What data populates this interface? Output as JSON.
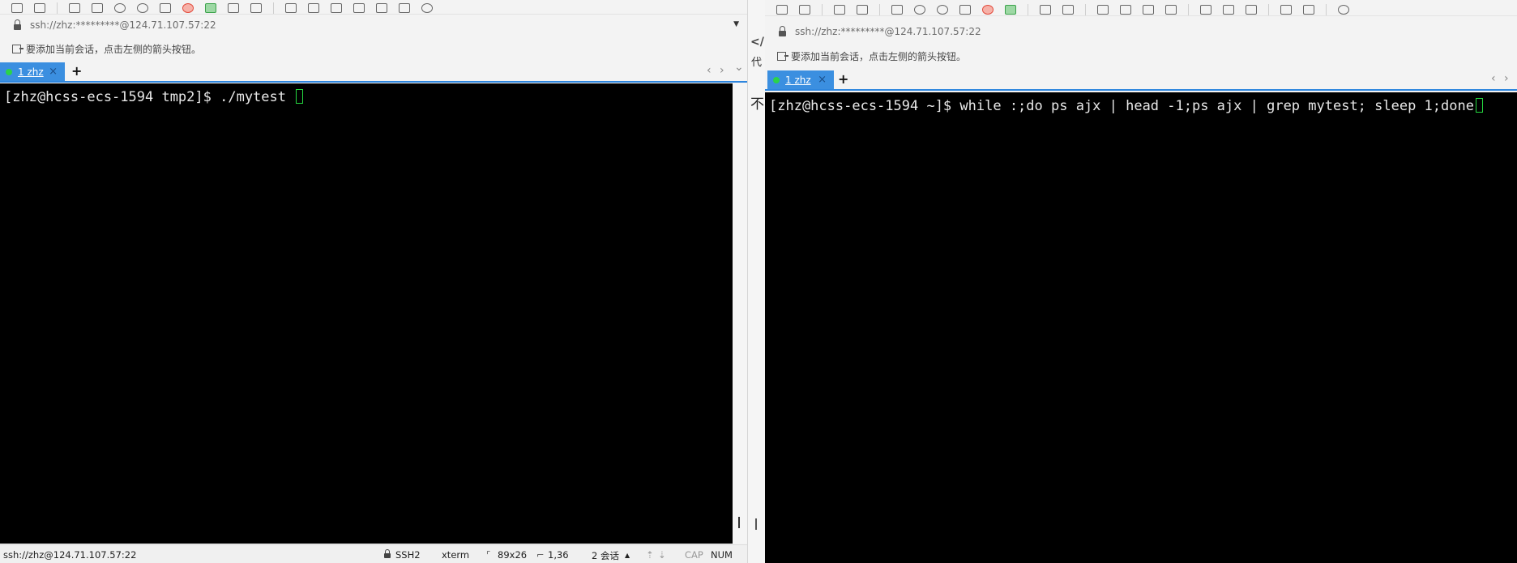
{
  "left": {
    "address": "ssh://zhz:*********@124.71.107.57:22",
    "hint": "要添加当前会话，点击左侧的箭头按钮。",
    "tab": {
      "label": "1 zhz",
      "close": "×"
    },
    "add_tab": "+",
    "tab_nav": {
      "prev": "‹",
      "next": "›",
      "menu": "⌄"
    },
    "terminal": {
      "prompt": "[zhz@hcss-ecs-1594 tmp2]$ ",
      "command": "./mytest "
    }
  },
  "divider": {
    "code_glyph": "</>",
    "char_top": "代",
    "char_mid": "不"
  },
  "right": {
    "address": "ssh://zhz:*********@124.71.107.57:22",
    "hint": "要添加当前会话，点击左侧的箭头按钮。",
    "tab": {
      "label": "1 zhz",
      "close": "×"
    },
    "add_tab": "+",
    "tab_nav": {
      "prev": "‹",
      "next": "›"
    },
    "terminal": {
      "prompt": "[zhz@hcss-ecs-1594 ~]$ ",
      "command": "while :;do ps ajx | head -1;ps ajx | grep mytest; sleep 1;done"
    }
  },
  "status_bar": {
    "connection": "ssh://zhz@124.71.107.57:22",
    "protocol": "SSH2",
    "term_type": "xterm",
    "size": "89x26",
    "cursor_pos": "1,36",
    "sessions": "2 会话",
    "up": "▲",
    "down": "▼",
    "caps": "CAP",
    "num": "NUM"
  },
  "colors": {
    "tab_active": "#3b8fe0",
    "tab_dot": "#2bd34a",
    "cursor": "#25d840",
    "terminal_bg": "#000000"
  }
}
